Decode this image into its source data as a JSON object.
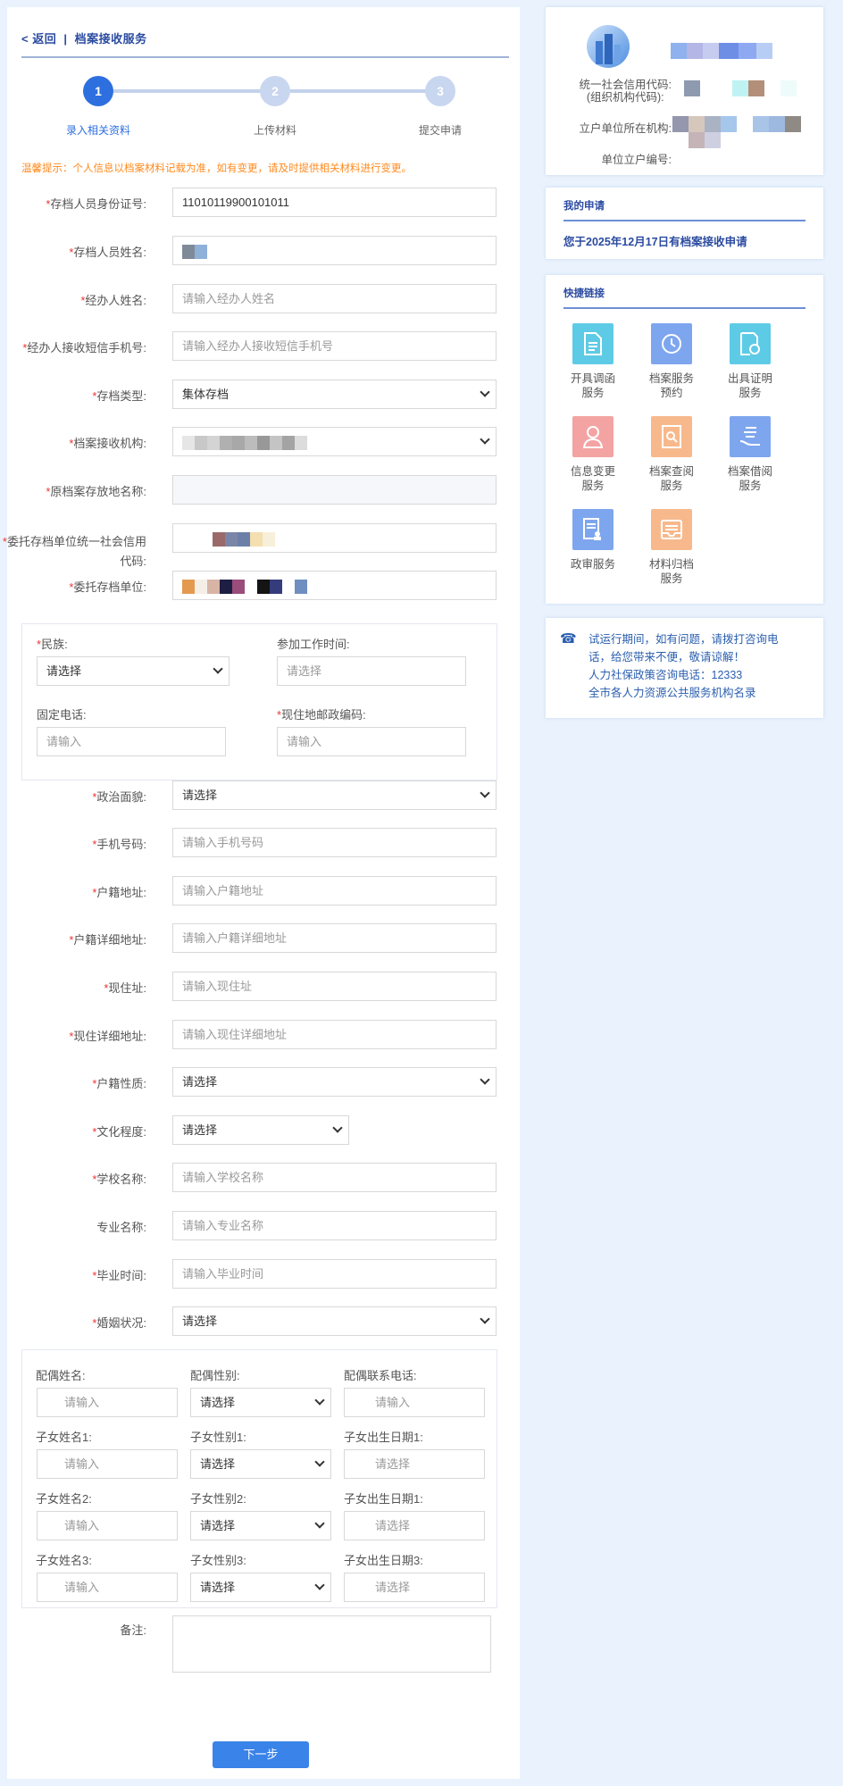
{
  "header": {
    "back_label": "< 返回",
    "separator": "|",
    "title": "档案接收服务"
  },
  "steps": [
    {
      "num": "1",
      "label": "录入相关资料",
      "active": true
    },
    {
      "num": "2",
      "label": "上传材料",
      "active": false
    },
    {
      "num": "3",
      "label": "提交申请",
      "active": false
    }
  ],
  "notice": "温馨提示：个人信息以档案材料记载为准，如有变更，请及时提供相关材料进行变更。",
  "form": {
    "id_number": {
      "label": "存档人员身份证号:",
      "value": "11010119900101011"
    },
    "name": {
      "label": "存档人员姓名:"
    },
    "agent_name": {
      "label": "经办人姓名:",
      "placeholder": "请输入经办人姓名"
    },
    "agent_phone": {
      "label": "经办人接收短信手机号:",
      "placeholder": "请输入经办人接收短信手机号"
    },
    "archive_type": {
      "label": "存档类型:",
      "value": "集体存档"
    },
    "receiving_org": {
      "label": "档案接收机构:"
    },
    "original_location": {
      "label": "原档案存放地名称:"
    },
    "credit_code": {
      "label_line1": "委托存档单位统一社会信用",
      "label_line2": "代码:"
    },
    "entrusting_unit": {
      "label": "委托存档单位:"
    },
    "ethnicity": {
      "label": "民族:",
      "value": "请选择"
    },
    "work_start": {
      "label": "参加工作时间:",
      "placeholder": "请选择"
    },
    "landline": {
      "label": "固定电话:",
      "placeholder": "请输入"
    },
    "postcode": {
      "label": "现住地邮政编码:",
      "placeholder": "请输入"
    },
    "political": {
      "label": "政治面貌:",
      "value": "请选择"
    },
    "mobile": {
      "label": "手机号码:",
      "placeholder": "请输入手机号码"
    },
    "hukou_addr": {
      "label": "户籍地址:",
      "placeholder": "请输入户籍地址"
    },
    "hukou_detail": {
      "label": "户籍详细地址:",
      "placeholder": "请输入户籍详细地址"
    },
    "current_addr": {
      "label": "现住址:",
      "placeholder": "请输入现住址"
    },
    "current_detail": {
      "label": "现住详细地址:",
      "placeholder": "请输入现住详细地址"
    },
    "hukou_type": {
      "label": "户籍性质:",
      "value": "请选择"
    },
    "education": {
      "label": "文化程度:",
      "value": "请选择"
    },
    "school": {
      "label": "学校名称:",
      "placeholder": "请输入学校名称"
    },
    "major": {
      "label": "专业名称:",
      "placeholder": "请输入专业名称"
    },
    "graduation": {
      "label": "毕业时间:",
      "placeholder": "请输入毕业时间"
    },
    "marital": {
      "label": "婚姻状况:",
      "value": "请选择"
    },
    "family": [
      [
        {
          "label": "配偶姓名:",
          "ph": "请输入"
        },
        {
          "label": "配偶性别:",
          "ph": "请选择"
        },
        {
          "label": "配偶联系电话:",
          "ph": "请输入"
        }
      ],
      [
        {
          "label": "子女姓名1:",
          "ph": "请输入"
        },
        {
          "label": "子女性别1:",
          "ph": "请选择"
        },
        {
          "label": "子女出生日期1:",
          "ph": "请选择"
        }
      ],
      [
        {
          "label": "子女姓名2:",
          "ph": "请输入"
        },
        {
          "label": "子女性别2:",
          "ph": "请选择"
        },
        {
          "label": "子女出生日期1:",
          "ph": "请选择"
        }
      ],
      [
        {
          "label": "子女姓名3:",
          "ph": "请输入"
        },
        {
          "label": "子女性别3:",
          "ph": "请选择"
        },
        {
          "label": "子女出生日期3:",
          "ph": "请选择"
        }
      ]
    ],
    "remarks": {
      "label": "备注:"
    }
  },
  "next_button": "下一步",
  "org_card": {
    "credit_code_label_1": "统一社会信用代码:",
    "credit_code_label_2": "(组织机构代码):",
    "org_label": "立户单位所在机构:",
    "unit_no_label": "单位立户编号:"
  },
  "my_apply": {
    "title": "我的申请",
    "text": "您于2025年12月17日有档案接收申请"
  },
  "quick_links": {
    "title": "快捷链接",
    "items": [
      {
        "l1": "开具调函",
        "l2": "服务",
        "color": "#5ecbe6",
        "icon": "document-icon"
      },
      {
        "l1": "档案服务",
        "l2": "预约",
        "color": "#7ea6ee",
        "icon": "clock-icon"
      },
      {
        "l1": "出具证明",
        "l2": "服务",
        "color": "#5ecbe6",
        "icon": "certificate-icon"
      },
      {
        "l1": "信息变更",
        "l2": "服务",
        "color": "#f4a3a3",
        "icon": "user-icon"
      },
      {
        "l1": "档案查阅",
        "l2": "服务",
        "color": "#f7b98c",
        "icon": "search-document-icon"
      },
      {
        "l1": "档案借阅",
        "l2": "服务",
        "color": "#7ea6ee",
        "icon": "hand-icon"
      },
      {
        "l1": "政审服务",
        "l2": "",
        "color": "#7ea6ee",
        "icon": "review-icon"
      },
      {
        "l1": "材料归档",
        "l2": "服务",
        "color": "#f7b98c",
        "icon": "archive-icon"
      }
    ]
  },
  "contact": {
    "line1": "试运行期间，如有问题，请拨打咨询电",
    "line2": "话，给您带来不便，敬请谅解！",
    "line3": "人力社保政策咨询电话：12333",
    "line4": "全市各人力资源公共服务机构名录"
  }
}
